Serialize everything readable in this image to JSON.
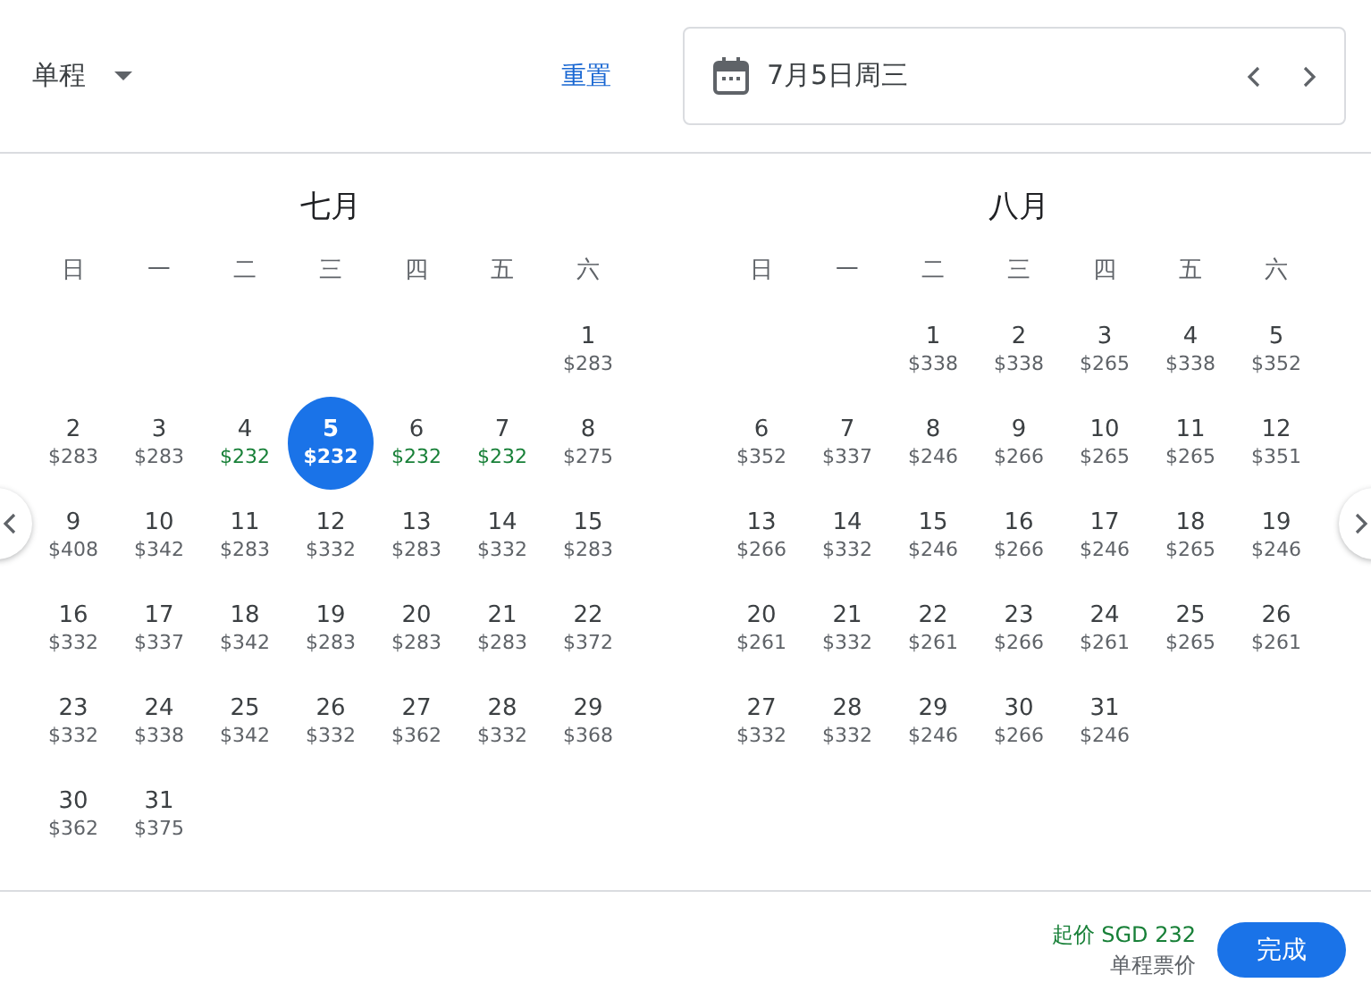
{
  "trip_type": {
    "label": "单程"
  },
  "reset_link": "重置",
  "date_field": {
    "value": "7月5日周三"
  },
  "months": [
    {
      "title": "七月",
      "weekdays": [
        "日",
        "一",
        "二",
        "三",
        "四",
        "五",
        "六"
      ],
      "weeks": [
        [
          {
            "kind": "blank"
          },
          {
            "kind": "blank"
          },
          {
            "kind": "blank"
          },
          {
            "kind": "blank"
          },
          {
            "kind": "blank"
          },
          {
            "kind": "blank"
          },
          {
            "kind": "day",
            "day": "1",
            "price": "$283",
            "low": false,
            "selected": false
          }
        ],
        [
          {
            "kind": "day",
            "day": "2",
            "price": "$283",
            "low": false,
            "selected": false
          },
          {
            "kind": "day",
            "day": "3",
            "price": "$283",
            "low": false,
            "selected": false
          },
          {
            "kind": "day",
            "day": "4",
            "price": "$232",
            "low": true,
            "selected": false
          },
          {
            "kind": "day",
            "day": "5",
            "price": "$232",
            "low": true,
            "selected": true
          },
          {
            "kind": "day",
            "day": "6",
            "price": "$232",
            "low": true,
            "selected": false
          },
          {
            "kind": "day",
            "day": "7",
            "price": "$232",
            "low": true,
            "selected": false
          },
          {
            "kind": "day",
            "day": "8",
            "price": "$275",
            "low": false,
            "selected": false
          }
        ],
        [
          {
            "kind": "day",
            "day": "9",
            "price": "$408",
            "low": false,
            "selected": false
          },
          {
            "kind": "day",
            "day": "10",
            "price": "$342",
            "low": false,
            "selected": false
          },
          {
            "kind": "day",
            "day": "11",
            "price": "$283",
            "low": false,
            "selected": false
          },
          {
            "kind": "day",
            "day": "12",
            "price": "$332",
            "low": false,
            "selected": false
          },
          {
            "kind": "day",
            "day": "13",
            "price": "$283",
            "low": false,
            "selected": false
          },
          {
            "kind": "day",
            "day": "14",
            "price": "$332",
            "low": false,
            "selected": false
          },
          {
            "kind": "day",
            "day": "15",
            "price": "$283",
            "low": false,
            "selected": false
          }
        ],
        [
          {
            "kind": "day",
            "day": "16",
            "price": "$332",
            "low": false,
            "selected": false
          },
          {
            "kind": "day",
            "day": "17",
            "price": "$337",
            "low": false,
            "selected": false
          },
          {
            "kind": "day",
            "day": "18",
            "price": "$342",
            "low": false,
            "selected": false
          },
          {
            "kind": "day",
            "day": "19",
            "price": "$283",
            "low": false,
            "selected": false
          },
          {
            "kind": "day",
            "day": "20",
            "price": "$283",
            "low": false,
            "selected": false
          },
          {
            "kind": "day",
            "day": "21",
            "price": "$283",
            "low": false,
            "selected": false
          },
          {
            "kind": "day",
            "day": "22",
            "price": "$372",
            "low": false,
            "selected": false
          }
        ],
        [
          {
            "kind": "day",
            "day": "23",
            "price": "$332",
            "low": false,
            "selected": false
          },
          {
            "kind": "day",
            "day": "24",
            "price": "$338",
            "low": false,
            "selected": false
          },
          {
            "kind": "day",
            "day": "25",
            "price": "$342",
            "low": false,
            "selected": false
          },
          {
            "kind": "day",
            "day": "26",
            "price": "$332",
            "low": false,
            "selected": false
          },
          {
            "kind": "day",
            "day": "27",
            "price": "$362",
            "low": false,
            "selected": false
          },
          {
            "kind": "day",
            "day": "28",
            "price": "$332",
            "low": false,
            "selected": false
          },
          {
            "kind": "day",
            "day": "29",
            "price": "$368",
            "low": false,
            "selected": false
          }
        ],
        [
          {
            "kind": "day",
            "day": "30",
            "price": "$362",
            "low": false,
            "selected": false
          },
          {
            "kind": "day",
            "day": "31",
            "price": "$375",
            "low": false,
            "selected": false
          }
        ]
      ]
    },
    {
      "title": "八月",
      "weekdays": [
        "日",
        "一",
        "二",
        "三",
        "四",
        "五",
        "六"
      ],
      "weeks": [
        [
          {
            "kind": "blank"
          },
          {
            "kind": "blank"
          },
          {
            "kind": "day",
            "day": "1",
            "price": "$338",
            "low": false,
            "selected": false
          },
          {
            "kind": "day",
            "day": "2",
            "price": "$338",
            "low": false,
            "selected": false
          },
          {
            "kind": "day",
            "day": "3",
            "price": "$265",
            "low": false,
            "selected": false
          },
          {
            "kind": "day",
            "day": "4",
            "price": "$338",
            "low": false,
            "selected": false
          },
          {
            "kind": "day",
            "day": "5",
            "price": "$352",
            "low": false,
            "selected": false
          }
        ],
        [
          {
            "kind": "day",
            "day": "6",
            "price": "$352",
            "low": false,
            "selected": false
          },
          {
            "kind": "day",
            "day": "7",
            "price": "$337",
            "low": false,
            "selected": false
          },
          {
            "kind": "day",
            "day": "8",
            "price": "$246",
            "low": false,
            "selected": false
          },
          {
            "kind": "day",
            "day": "9",
            "price": "$266",
            "low": false,
            "selected": false
          },
          {
            "kind": "day",
            "day": "10",
            "price": "$265",
            "low": false,
            "selected": false
          },
          {
            "kind": "day",
            "day": "11",
            "price": "$265",
            "low": false,
            "selected": false
          },
          {
            "kind": "day",
            "day": "12",
            "price": "$351",
            "low": false,
            "selected": false
          }
        ],
        [
          {
            "kind": "day",
            "day": "13",
            "price": "$266",
            "low": false,
            "selected": false
          },
          {
            "kind": "day",
            "day": "14",
            "price": "$332",
            "low": false,
            "selected": false
          },
          {
            "kind": "day",
            "day": "15",
            "price": "$246",
            "low": false,
            "selected": false
          },
          {
            "kind": "day",
            "day": "16",
            "price": "$266",
            "low": false,
            "selected": false
          },
          {
            "kind": "day",
            "day": "17",
            "price": "$246",
            "low": false,
            "selected": false
          },
          {
            "kind": "day",
            "day": "18",
            "price": "$265",
            "low": false,
            "selected": false
          },
          {
            "kind": "day",
            "day": "19",
            "price": "$246",
            "low": false,
            "selected": false
          }
        ],
        [
          {
            "kind": "day",
            "day": "20",
            "price": "$261",
            "low": false,
            "selected": false
          },
          {
            "kind": "day",
            "day": "21",
            "price": "$332",
            "low": false,
            "selected": false
          },
          {
            "kind": "day",
            "day": "22",
            "price": "$261",
            "low": false,
            "selected": false
          },
          {
            "kind": "day",
            "day": "23",
            "price": "$266",
            "low": false,
            "selected": false
          },
          {
            "kind": "day",
            "day": "24",
            "price": "$261",
            "low": false,
            "selected": false
          },
          {
            "kind": "day",
            "day": "25",
            "price": "$265",
            "low": false,
            "selected": false
          },
          {
            "kind": "day",
            "day": "26",
            "price": "$261",
            "low": false,
            "selected": false
          }
        ],
        [
          {
            "kind": "day",
            "day": "27",
            "price": "$332",
            "low": false,
            "selected": false
          },
          {
            "kind": "day",
            "day": "28",
            "price": "$332",
            "low": false,
            "selected": false
          },
          {
            "kind": "day",
            "day": "29",
            "price": "$246",
            "low": false,
            "selected": false
          },
          {
            "kind": "day",
            "day": "30",
            "price": "$266",
            "low": false,
            "selected": false
          },
          {
            "kind": "day",
            "day": "31",
            "price": "$246",
            "low": false,
            "selected": false
          }
        ]
      ]
    }
  ],
  "footer": {
    "price": "起价 SGD 232",
    "note": "单程票价",
    "button": "完成"
  }
}
